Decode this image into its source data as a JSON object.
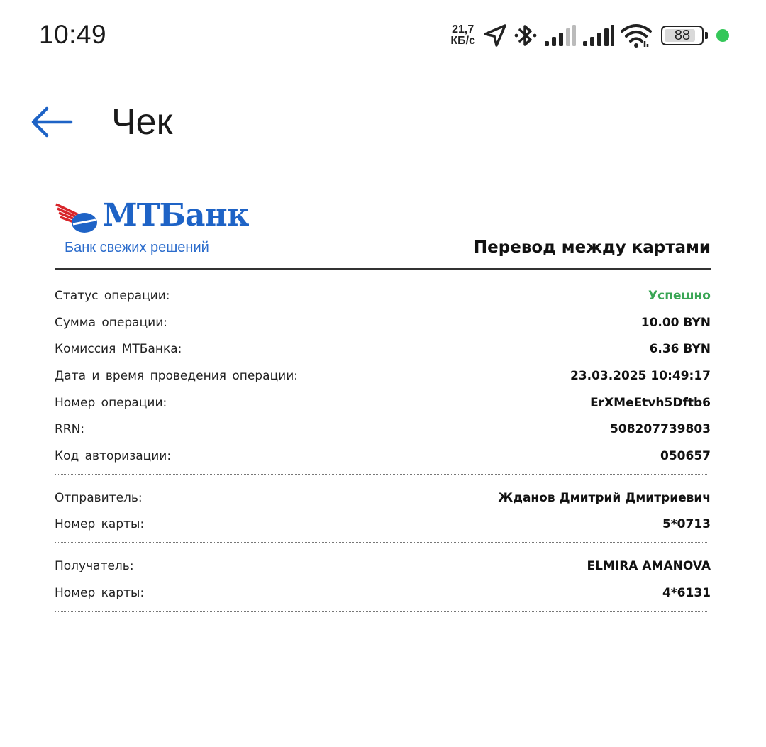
{
  "status_bar": {
    "time": "10:49",
    "net_speed_value": "21,7",
    "net_speed_unit": "КБ/с",
    "battery_level": "88",
    "icons": [
      "location-arrow-icon",
      "bluetooth-icon",
      "signal-sim1-icon",
      "signal-sim2-icon",
      "wifi-icon",
      "battery-icon",
      "green-dot-indicator"
    ]
  },
  "app_bar": {
    "back_icon": "arrow-left-icon",
    "title": "Чек"
  },
  "receipt": {
    "logo_word": "МТБанк",
    "logo_slogan": "Банк свежих решений",
    "title": "Перевод между картами",
    "operation": [
      {
        "label": "Статус операции:",
        "value": "Успешно"
      },
      {
        "label": "Сумма операции:",
        "value": "10.00 BYN"
      },
      {
        "label": "Комиссия МТБанка:",
        "value": "6.36 BYN"
      },
      {
        "label": "Дата и время проведения операции:",
        "value": "23.03.2025 10:49:17"
      },
      {
        "label": "Номер операции:",
        "value": "ErXMeEtvh5Dftb6"
      },
      {
        "label": "RRN:",
        "value": "508207739803"
      },
      {
        "label": "Код авторизации:",
        "value": "050657"
      }
    ],
    "sender": [
      {
        "label": "Отправитель:",
        "value": "Жданов Дмитрий Дмитриевич"
      },
      {
        "label": "Номер карты:",
        "value": "5*0713"
      }
    ],
    "recipient": [
      {
        "label": "Получатель:",
        "value": "ELMIRA AMANOVA"
      },
      {
        "label": "Номер карты:",
        "value": "4*6131"
      }
    ]
  },
  "colors": {
    "accent_blue": "#1e63c6",
    "logo_red": "#d8262b",
    "success_green": "#3aa655",
    "status_dot": "#34c759"
  }
}
